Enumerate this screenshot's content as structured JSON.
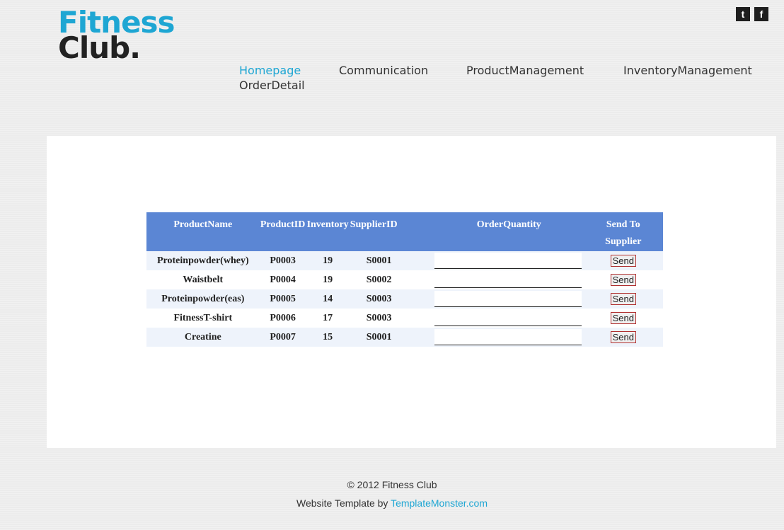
{
  "logo": {
    "line1": "Fitness",
    "line2": "Club."
  },
  "social": {
    "twitter_glyph": "t",
    "facebook_glyph": "f"
  },
  "nav": {
    "homepage": "Homepage",
    "communication": "Communication",
    "product_management": "ProductManagement",
    "inventory_management": "InventoryManagement",
    "order_detail": "OrderDetail"
  },
  "table": {
    "headers": {
      "product_name": "ProductName",
      "product_id": "ProductID",
      "inventory": "Inventory",
      "supplier_id": "SupplierID",
      "order_quantity": "OrderQuantity",
      "send_to_supplier_1": "Send To",
      "send_to_supplier_2": "Supplier"
    },
    "rows": [
      {
        "name": "Proteinpowder(whey)",
        "id": "P0003",
        "inventory": "19",
        "supplier": "S0001",
        "quantity": "",
        "send": "Send"
      },
      {
        "name": "Waistbelt",
        "id": "P0004",
        "inventory": "19",
        "supplier": "S0002",
        "quantity": "",
        "send": "Send"
      },
      {
        "name": "Proteinpowder(eas)",
        "id": "P0005",
        "inventory": "14",
        "supplier": "S0003",
        "quantity": "",
        "send": "Send"
      },
      {
        "name": "FitnessT-shirt",
        "id": "P0006",
        "inventory": "17",
        "supplier": "S0003",
        "quantity": "",
        "send": "Send"
      },
      {
        "name": "Creatine",
        "id": "P0007",
        "inventory": "15",
        "supplier": "S0001",
        "quantity": "",
        "send": "Send"
      }
    ]
  },
  "footer": {
    "copyright": "© 2012 Fitness Club",
    "template_prefix": "Website Template by ",
    "template_link": "TemplateMonster.com"
  },
  "colors": {
    "accent": "#1ea6d3",
    "header_bg": "#5b86d4",
    "row_alt": "#eef3fb"
  }
}
